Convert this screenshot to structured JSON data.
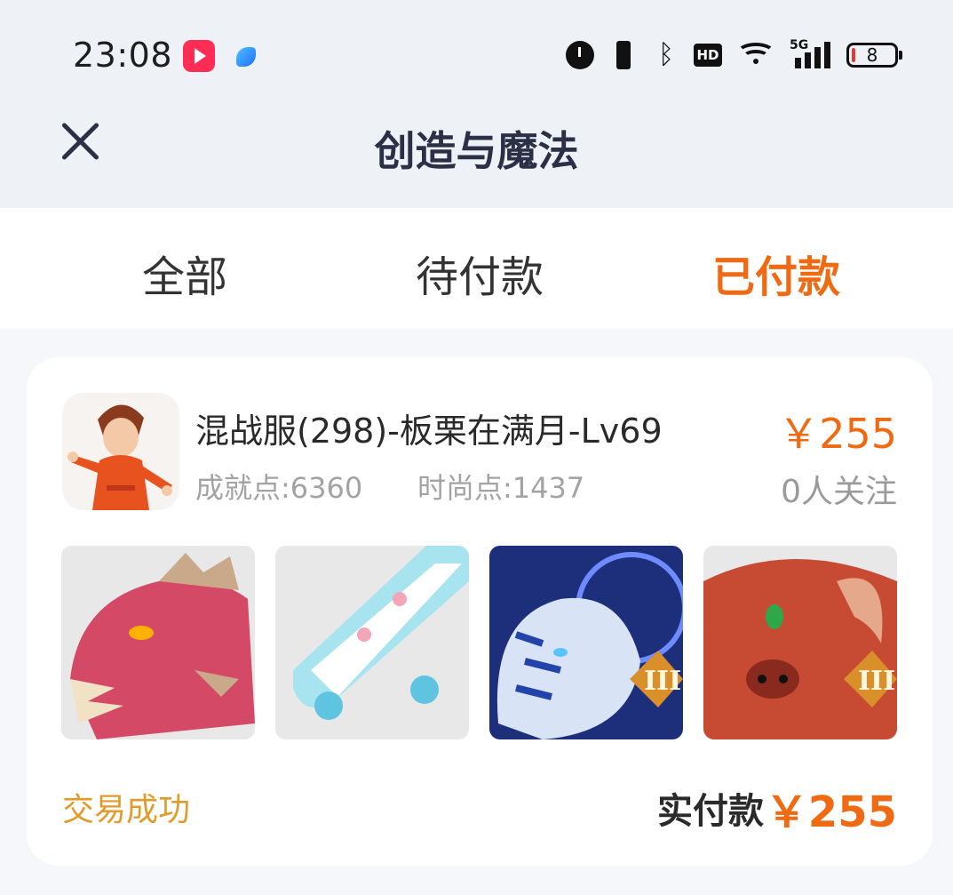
{
  "status_bar": {
    "time": "23:08",
    "app_icons": [
      "video-app-icon",
      "feather-app-icon"
    ],
    "indicators": [
      "alarm-icon",
      "vibrate-icon",
      "bluetooth-icon",
      "hd-icon",
      "wifi-icon",
      "signal-5g-icon",
      "battery-icon"
    ],
    "network_label": "5G",
    "hd_label": "HD",
    "battery_level": "8"
  },
  "header": {
    "title": "创造与魔法",
    "close_icon": "close-icon"
  },
  "tabs": [
    {
      "label": "全部",
      "active": false
    },
    {
      "label": "待付款",
      "active": false
    },
    {
      "label": "已付款",
      "active": true
    }
  ],
  "order": {
    "title": "混战服(298)-板栗在满月-Lv69",
    "achievement": "成就点:6360",
    "fashion": "时尚点:1437",
    "price": "￥255",
    "followers": "0人关注",
    "thumbnails": [
      "dragon-mount-image",
      "skateboard-image",
      "tiger-mount-image",
      "bull-demon-image"
    ],
    "status": "交易成功",
    "paid_label": "实付款",
    "paid_amount": "￥255"
  },
  "colors": {
    "accent": "#ef6a12",
    "status": "#e09b2a",
    "title": "#2b3046"
  }
}
